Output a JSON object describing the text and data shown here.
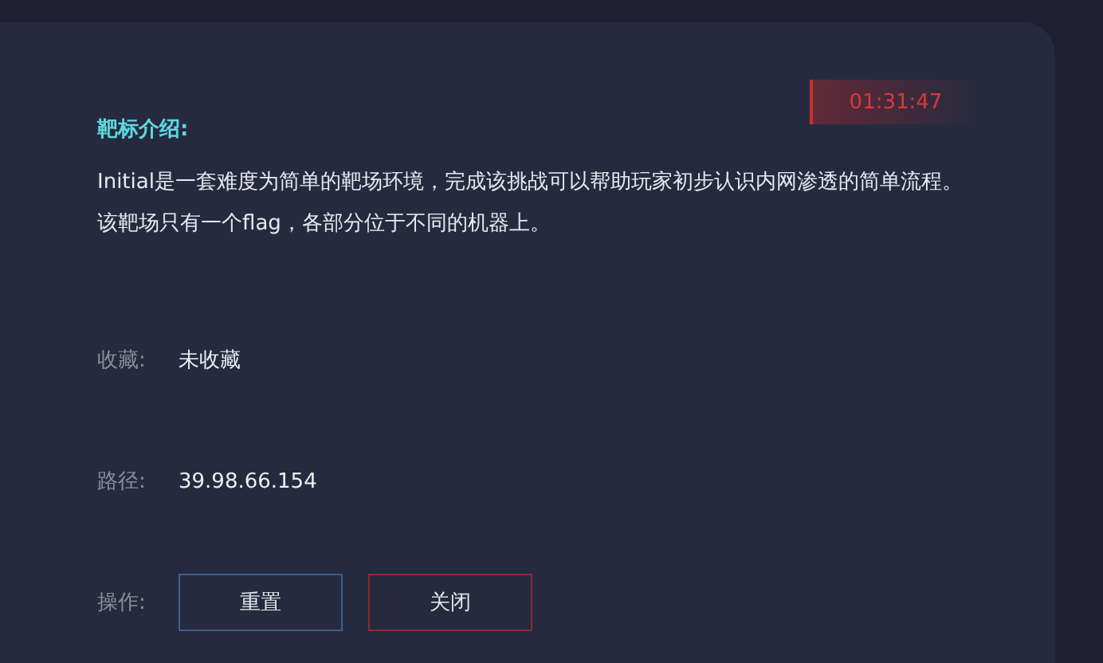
{
  "timer": "01:31:47",
  "intro": {
    "title": "靶标介绍:",
    "text": "Initial是一套难度为简单的靶场环境，完成该挑战可以帮助玩家初步认识内网渗透的简单流程。该靶场只有一个flag，各部分位于不同的机器上。"
  },
  "fields": [
    {
      "label": "收藏:",
      "value": "未收藏"
    },
    {
      "label": "路径:",
      "value": "39.98.66.154"
    }
  ],
  "actions": {
    "label": "操作:",
    "buttons": [
      {
        "label": "重置",
        "kind": "primary"
      },
      {
        "label": "关闭",
        "kind": "danger"
      }
    ]
  }
}
